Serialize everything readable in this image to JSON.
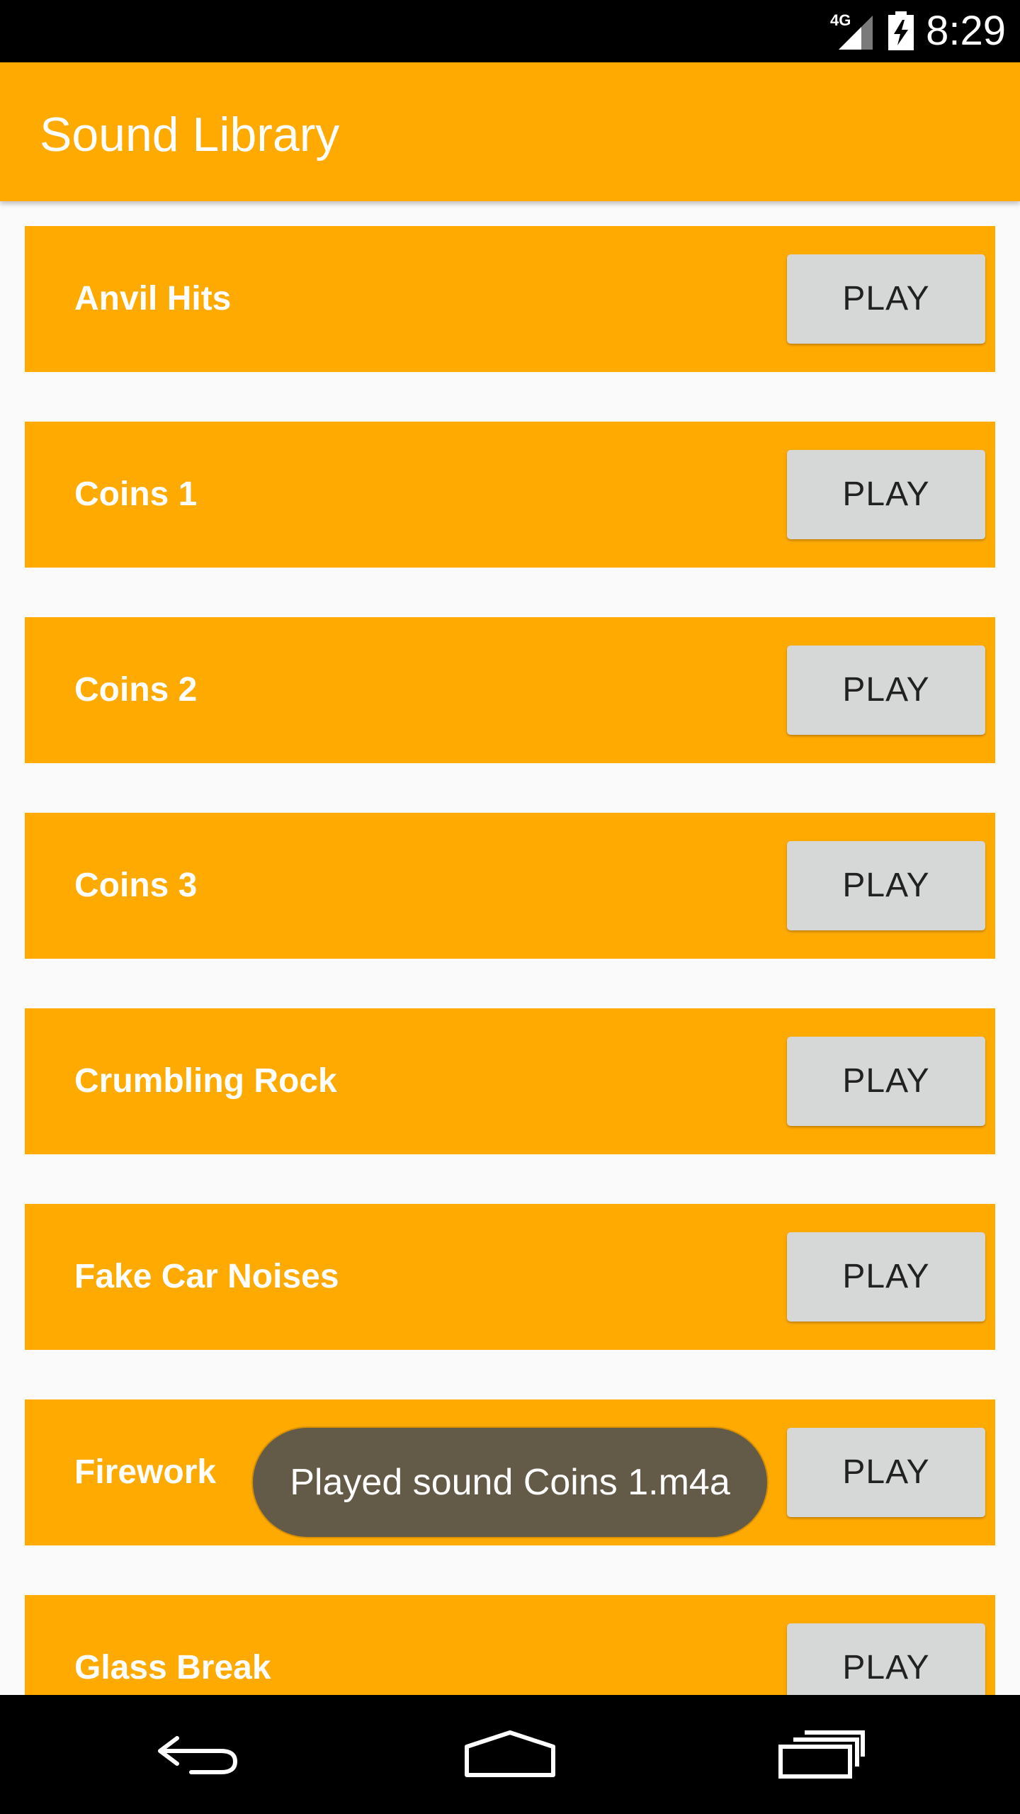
{
  "status_bar": {
    "network": "4G",
    "time": "8:29",
    "icons": [
      "signal-icon",
      "battery-charging-icon"
    ]
  },
  "app_bar": {
    "title": "Sound Library"
  },
  "colors": {
    "accent": "#ffaa00",
    "button": "#d6d7d7",
    "toast": "#635b48",
    "background": "#fafafa"
  },
  "sounds": [
    {
      "name": "Anvil Hits",
      "button": "PLAY"
    },
    {
      "name": "Coins 1",
      "button": "PLAY"
    },
    {
      "name": "Coins 2",
      "button": "PLAY"
    },
    {
      "name": "Coins 3",
      "button": "PLAY"
    },
    {
      "name": "Crumbling Rock",
      "button": "PLAY"
    },
    {
      "name": "Fake Car Noises",
      "button": "PLAY"
    },
    {
      "name": "Firework",
      "button": "PLAY"
    },
    {
      "name": "Glass Break",
      "button": "PLAY"
    }
  ],
  "toast": {
    "message": "Played sound Coins 1.m4a"
  },
  "nav_bar": {
    "icons": [
      "back-icon",
      "home-icon",
      "recents-icon"
    ]
  }
}
